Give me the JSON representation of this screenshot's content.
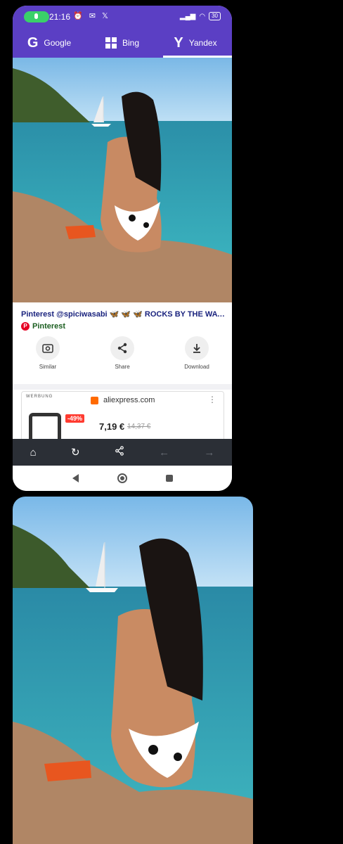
{
  "status_bar": {
    "time": "21:16",
    "battery": "30"
  },
  "search_engines": [
    {
      "label": "Google",
      "glyph": "G",
      "active": false
    },
    {
      "label": "Bing",
      "glyph": "windows-grid",
      "active": false
    },
    {
      "label": "Yandex",
      "glyph": "Y",
      "active": true
    }
  ],
  "result": {
    "title": "Pinterest @spiciwasabi 🦋 🦋 🦋 ROCKS BY THE WATE...",
    "source": "Pinterest"
  },
  "actions": [
    {
      "label": "Similar",
      "icon": "image-search-icon"
    },
    {
      "label": "Share",
      "icon": "share-icon"
    },
    {
      "label": "Download",
      "icon": "download-icon"
    }
  ],
  "ad": {
    "label": "WERBUNG",
    "domain": "aliexpress.com",
    "discount": "-49%",
    "price": "7,19 €",
    "old_price": "14,37 €"
  },
  "colors": {
    "accent": "#5b3fc4",
    "toolbar": "#2b2f36"
  }
}
